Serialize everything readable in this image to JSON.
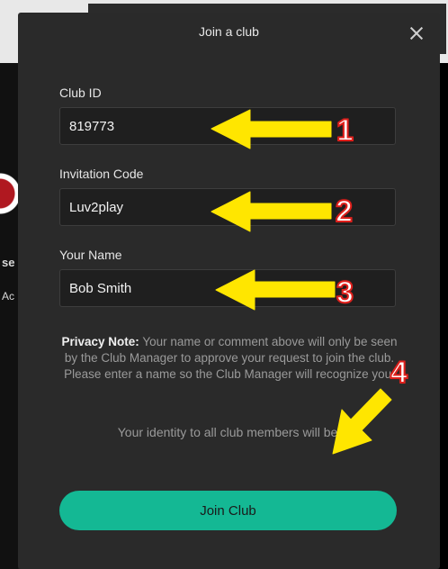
{
  "modal": {
    "title": "Join a club",
    "close_icon": "close-icon"
  },
  "form": {
    "club_id": {
      "label": "Club ID",
      "value": "819773"
    },
    "invitation_code": {
      "label": "Invitation Code",
      "value": "Luv2play"
    },
    "your_name": {
      "label": "Your Name",
      "value": "Bob Smith"
    }
  },
  "privacy": {
    "heading": "Privacy Note:",
    "body": " Your name or comment above will only be seen by the Club Manager to approve your request to join the club. Please enter a name so the Club Manager will recognize you."
  },
  "identity_text": "Your identity to all club members will be: ",
  "join_button": "Join Club",
  "annotations": {
    "numbers": [
      "1",
      "2",
      "3",
      "4"
    ],
    "arrow_color": "#ffe600",
    "number_outline_color": "#e0201c"
  },
  "background_text": [
    "se",
    "Ac"
  ]
}
